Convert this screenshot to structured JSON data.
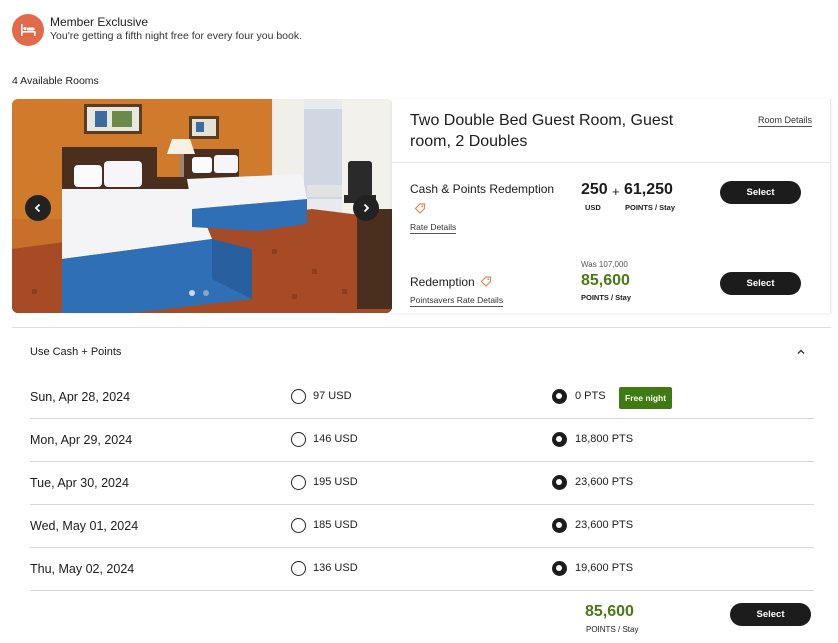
{
  "banner": {
    "title": "Member Exclusive",
    "subtitle": "You're getting a fifth night free for every four you book.",
    "icon": "bed-icon",
    "accent": "#e06a4a"
  },
  "available_rooms": "4 Available Rooms",
  "room": {
    "title": "Two Double Bed Guest Room, Guest room, 2 Doubles",
    "details_link": "Room Details",
    "rates": [
      {
        "name": "Cash & Points Redemption",
        "link": "Rate Details",
        "cash": "250",
        "plus": "+",
        "points": "61,250",
        "cash_unit": "USD",
        "points_unit": "POINTS / Stay",
        "button": "Select"
      },
      {
        "name": "Redemption",
        "link": "Pointsavers Rate Details",
        "was": "Was 107,000",
        "points": "85,600",
        "points_unit": "POINTS / Stay",
        "button": "Select"
      }
    ]
  },
  "cash_points": {
    "title": "Use Cash + Points",
    "nights": [
      {
        "date": "Sun, Apr 28, 2024",
        "usd": "97 USD",
        "pts": "0 PTS",
        "badge": "Free night"
      },
      {
        "date": "Mon, Apr 29, 2024",
        "usd": "146 USD",
        "pts": "18,800 PTS"
      },
      {
        "date": "Tue, Apr 30, 2024",
        "usd": "195 USD",
        "pts": "23,600 PTS"
      },
      {
        "date": "Wed, May 01, 2024",
        "usd": "185 USD",
        "pts": "23,600 PTS"
      },
      {
        "date": "Thu, May 02, 2024",
        "usd": "136 USD",
        "pts": "19,600 PTS"
      }
    ],
    "total_points": "85,600",
    "total_unit": "POINTS / Stay",
    "button": "Select"
  },
  "colors": {
    "points_green": "#4a7a12",
    "badge_green": "#3f7a13",
    "button_dark": "#1c1c1c"
  }
}
